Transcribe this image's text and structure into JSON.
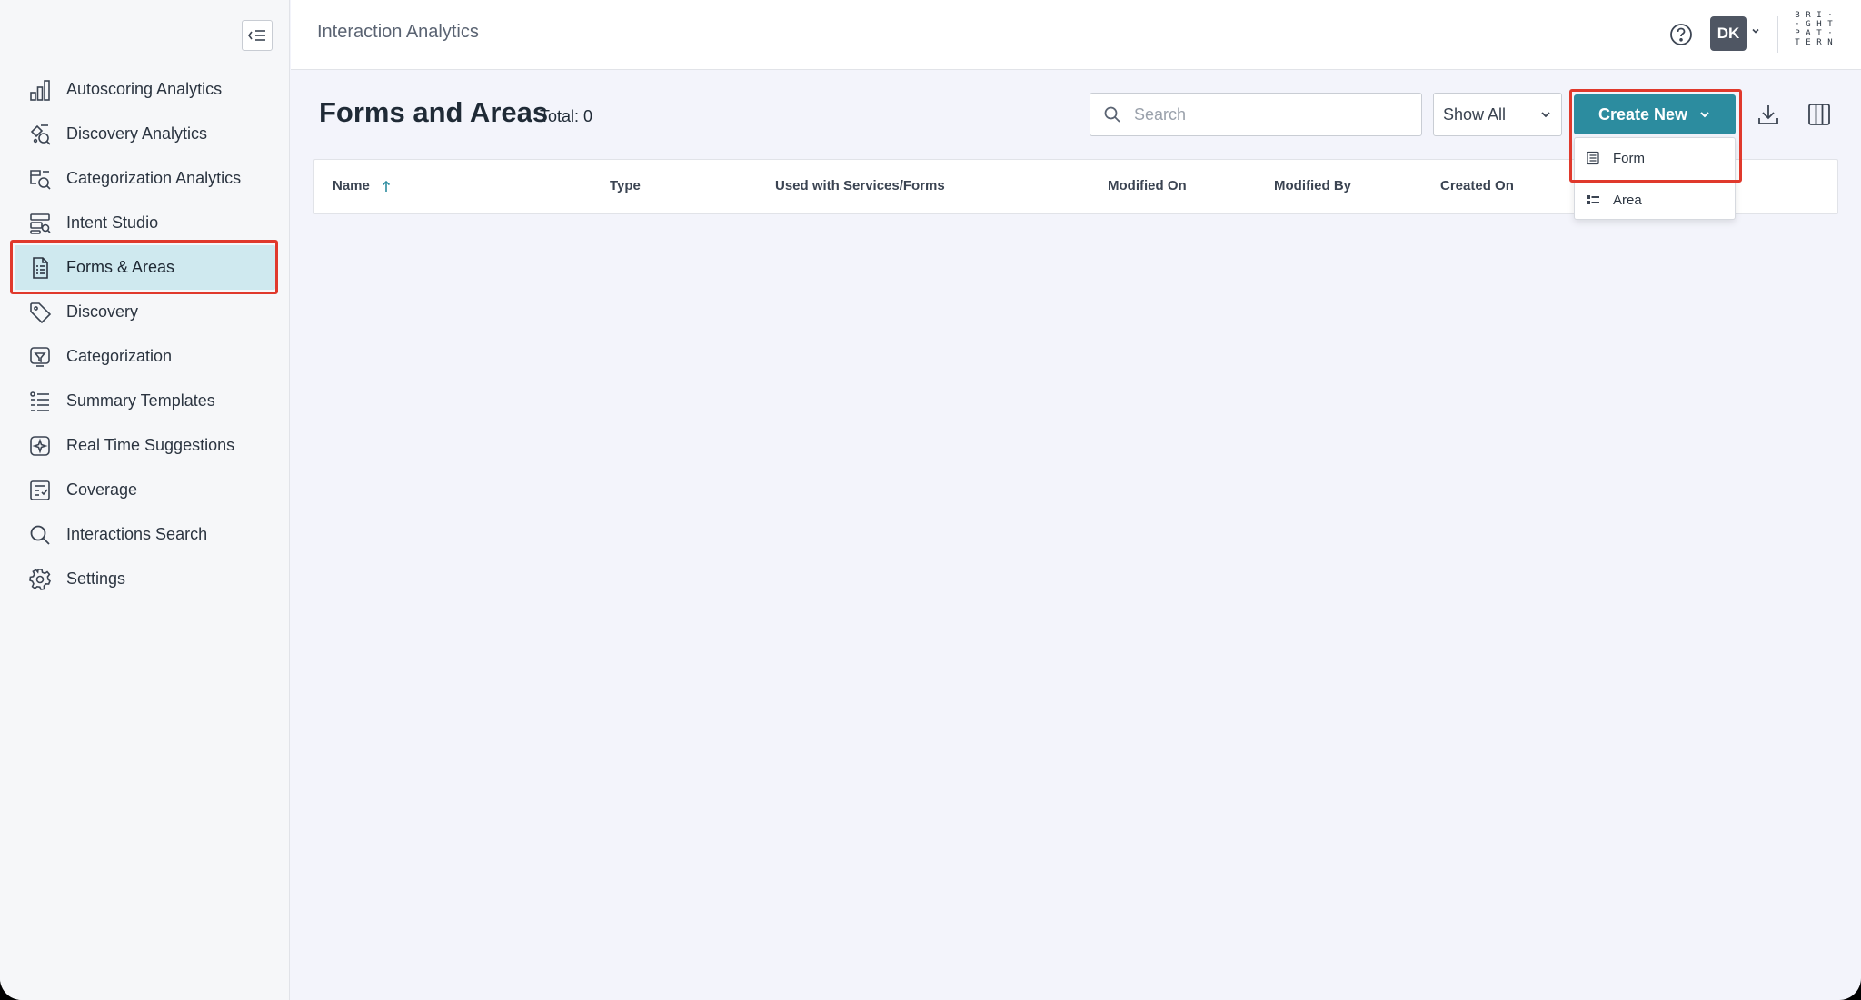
{
  "app": {
    "title": "Interaction Analytics"
  },
  "header": {
    "user_initials": "DK",
    "logo_letters": [
      "B",
      "R",
      "I",
      "·",
      "·",
      "G",
      "H",
      "T",
      "P",
      "A",
      "T",
      "·",
      "T",
      "E",
      "R",
      "N"
    ]
  },
  "sidebar": {
    "items": [
      {
        "label": "Autoscoring Analytics",
        "icon": "bar-chart-icon"
      },
      {
        "label": "Discovery Analytics",
        "icon": "discovery-analytics-icon"
      },
      {
        "label": "Categorization Analytics",
        "icon": "categorization-analytics-icon"
      },
      {
        "label": "Intent Studio",
        "icon": "intent-studio-icon"
      },
      {
        "label": "Forms & Areas",
        "icon": "form-document-icon",
        "active": true
      },
      {
        "label": "Discovery",
        "icon": "tag-icon"
      },
      {
        "label": "Categorization",
        "icon": "categorization-icon"
      },
      {
        "label": "Summary Templates",
        "icon": "summary-list-icon"
      },
      {
        "label": "Real Time Suggestions",
        "icon": "sparkle-icon"
      },
      {
        "label": "Coverage",
        "icon": "coverage-icon"
      },
      {
        "label": "Interactions Search",
        "icon": "search-icon"
      },
      {
        "label": "Settings",
        "icon": "gear-icon"
      }
    ]
  },
  "page": {
    "title": "Forms and Areas",
    "total": "Total: 0"
  },
  "toolbar": {
    "search_placeholder": "Search",
    "filter_value": "Show All",
    "create_label": "Create New"
  },
  "create_menu": {
    "items": [
      {
        "label": "Form",
        "icon": "form-icon"
      },
      {
        "label": "Area",
        "icon": "area-list-icon"
      }
    ]
  },
  "table": {
    "columns": [
      "Name",
      "Type",
      "Used with Services/Forms",
      "Modified On",
      "Modified By",
      "Created On"
    ],
    "sort_column": "Name",
    "sort_direction": "ascending",
    "rows": []
  },
  "colors": {
    "accent": "#2c8c9f",
    "active_nav": "#cfe9ef",
    "highlight_outline": "#e0392c"
  }
}
